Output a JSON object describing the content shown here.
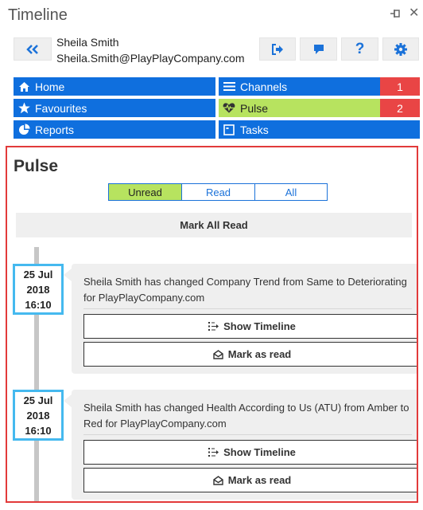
{
  "app": {
    "title": "Timeline"
  },
  "user": {
    "name": "Sheila Smith",
    "email": "Sheila.Smith@PlayPlayCompany.com"
  },
  "nav": {
    "home": "Home",
    "channels": "Channels",
    "channels_badge": "1",
    "favourites": "Favourites",
    "pulse": "Pulse",
    "pulse_badge": "2",
    "reports": "Reports",
    "tasks": "Tasks"
  },
  "pulse": {
    "title": "Pulse",
    "filters": {
      "unread": "Unread",
      "read": "Read",
      "all": "All"
    },
    "mark_all": "Mark All Read",
    "items": [
      {
        "day": "25 Jul",
        "year": "2018",
        "time": "16:10",
        "text": "Sheila Smith has changed Company Trend from Same to Deteriorating for PlayPlayCompany.com",
        "show_timeline": "Show Timeline",
        "mark_read": "Mark as read"
      },
      {
        "day": "25 Jul",
        "year": "2018",
        "time": "16:10",
        "text": "Sheila Smith has changed Health According to Us (ATU) from Amber to Red for PlayPlayCompany.com",
        "show_timeline": "Show Timeline",
        "mark_read": "Mark as read"
      }
    ]
  },
  "colors": {
    "nav_blue": "#0f6fde",
    "active_green": "#b7e35f",
    "badge_red": "#e94545",
    "date_border": "#45b9ef",
    "highlight_red": "#e23a3a"
  }
}
